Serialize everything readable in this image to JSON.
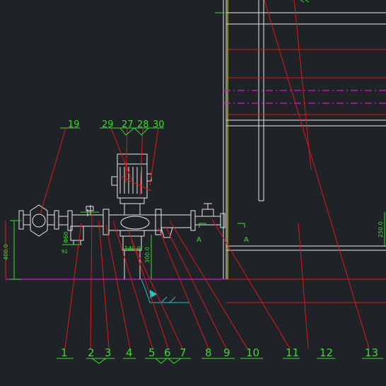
{
  "colors": {
    "background": "#1f2227",
    "frame": "#e8e8e8",
    "leader": "#e01818",
    "callout": "#3bdc2a",
    "dim": "#3bdc2a",
    "magenta": "#c81ec8",
    "cyan": "#1ec8c8",
    "yellow": "#e6e61a"
  },
  "callouts_bottom": [
    "1",
    "2",
    "3",
    "4",
    "5",
    "6",
    "7",
    "8",
    "9",
    "10",
    "11",
    "12",
    "13"
  ],
  "callouts_top": [
    "19",
    "29",
    "27",
    "28",
    "30"
  ],
  "dimensions": {
    "height_left": "400.0",
    "pipe_dia": "Φ60",
    "flange_spacing": "140.0",
    "pipe_depth": "300.0",
    "right_level": "250.0",
    "small_label": "92"
  },
  "section_marks": [
    "A",
    "A"
  ]
}
